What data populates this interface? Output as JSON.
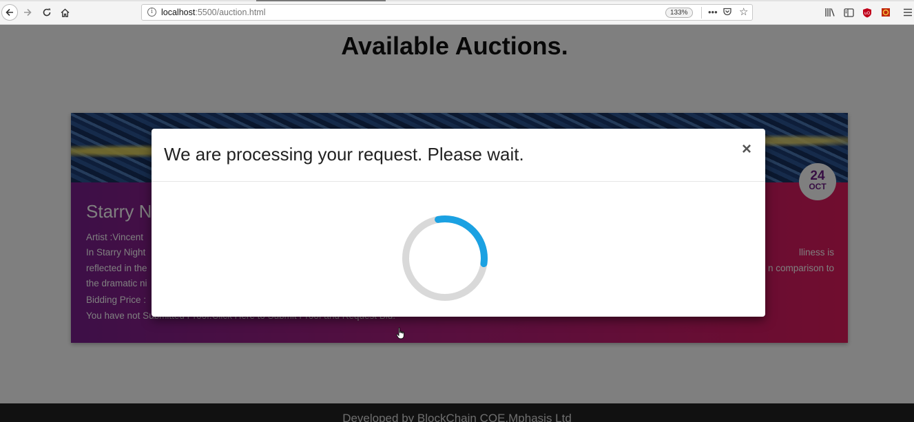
{
  "browser": {
    "url_host": "localhost",
    "url_rest": ":5500/auction.html",
    "zoom": "133%",
    "icons": [
      "back-arrow-icon",
      "forward-arrow-icon",
      "reload-icon",
      "home-icon",
      "info-icon",
      "page-actions-icon",
      "pocket-icon",
      "bookmark-star-icon",
      "library-icon",
      "sidebar-icon",
      "ublock-icon",
      "extension-icon",
      "menu-icon"
    ]
  },
  "page": {
    "title": "Available Auctions.",
    "card": {
      "date_day": "24",
      "date_month": "OCT",
      "title": "Starry N",
      "artist": "Artist :Vincent",
      "desc_line1_left": "In Starry Night",
      "desc_line1_right": "lliness is",
      "desc_line2_left": "reflected in the",
      "desc_line2_right": "n comparison to",
      "desc_line3_left": "the dramatic ni",
      "bidding": "Bidding Price :",
      "status": "You have not Submitted Proof.Click Here to Submit Proof and Request Bid."
    },
    "footer": "Developed by BlockChain COE,Mphasis Ltd"
  },
  "modal": {
    "title": "We are processing your request. Please wait.",
    "close": "×",
    "spinner_progress": 0.3
  },
  "colors": {
    "spinner_accent": "#1ba1e2",
    "spinner_track": "#d9d9d9",
    "card_gradient_start": "#7b1e8f",
    "card_gradient_end": "#e11a5d"
  }
}
